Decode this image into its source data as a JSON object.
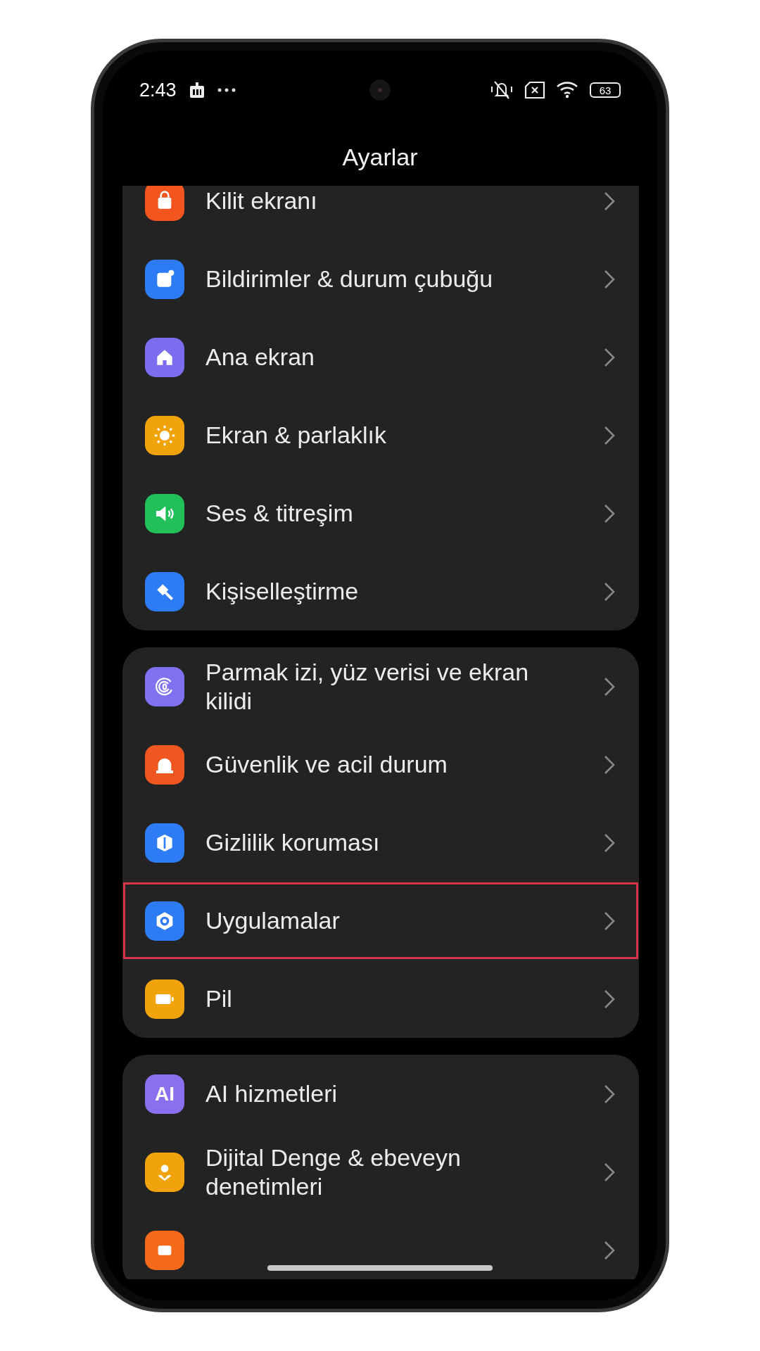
{
  "status_bar": {
    "time": "2:43",
    "battery": "63"
  },
  "title": "Ayarlar",
  "groups": [
    {
      "items": [
        {
          "label": "Kilit ekranı",
          "color": "#f2551e",
          "highlighted": false
        },
        {
          "label": "Bildirimler & durum çubuğu",
          "color": "#2d7cf6",
          "highlighted": false
        },
        {
          "label": "Ana ekran",
          "color": "#7b6cf0",
          "highlighted": false
        },
        {
          "label": "Ekran & parlaklık",
          "color": "#f1a30c",
          "highlighted": false
        },
        {
          "label": "Ses & titreşim",
          "color": "#22c05a",
          "highlighted": false
        },
        {
          "label": "Kişiselleştirme",
          "color": "#2d7cf6",
          "highlighted": false
        }
      ]
    },
    {
      "items": [
        {
          "label": "Parmak izi, yüz verisi ve ekran kilidi",
          "color": "#8071f0",
          "highlighted": false
        },
        {
          "label": "Güvenlik ve acil durum",
          "color": "#f0561f",
          "highlighted": false
        },
        {
          "label": "Gizlilik koruması",
          "color": "#2d7cf6",
          "highlighted": false
        },
        {
          "label": "Uygulamalar",
          "color": "#2d7cf6",
          "highlighted": true
        },
        {
          "label": "Pil",
          "color": "#f1a30c",
          "highlighted": false
        }
      ]
    },
    {
      "items": [
        {
          "label": "AI hizmetleri",
          "color": "#8a70ee",
          "badge_text": "AI",
          "highlighted": false
        },
        {
          "label": "Dijital Denge & ebeveyn denetimleri",
          "color": "#f1a30c",
          "highlighted": false
        },
        {
          "color": "#f56a18",
          "highlighted": false
        }
      ]
    }
  ]
}
